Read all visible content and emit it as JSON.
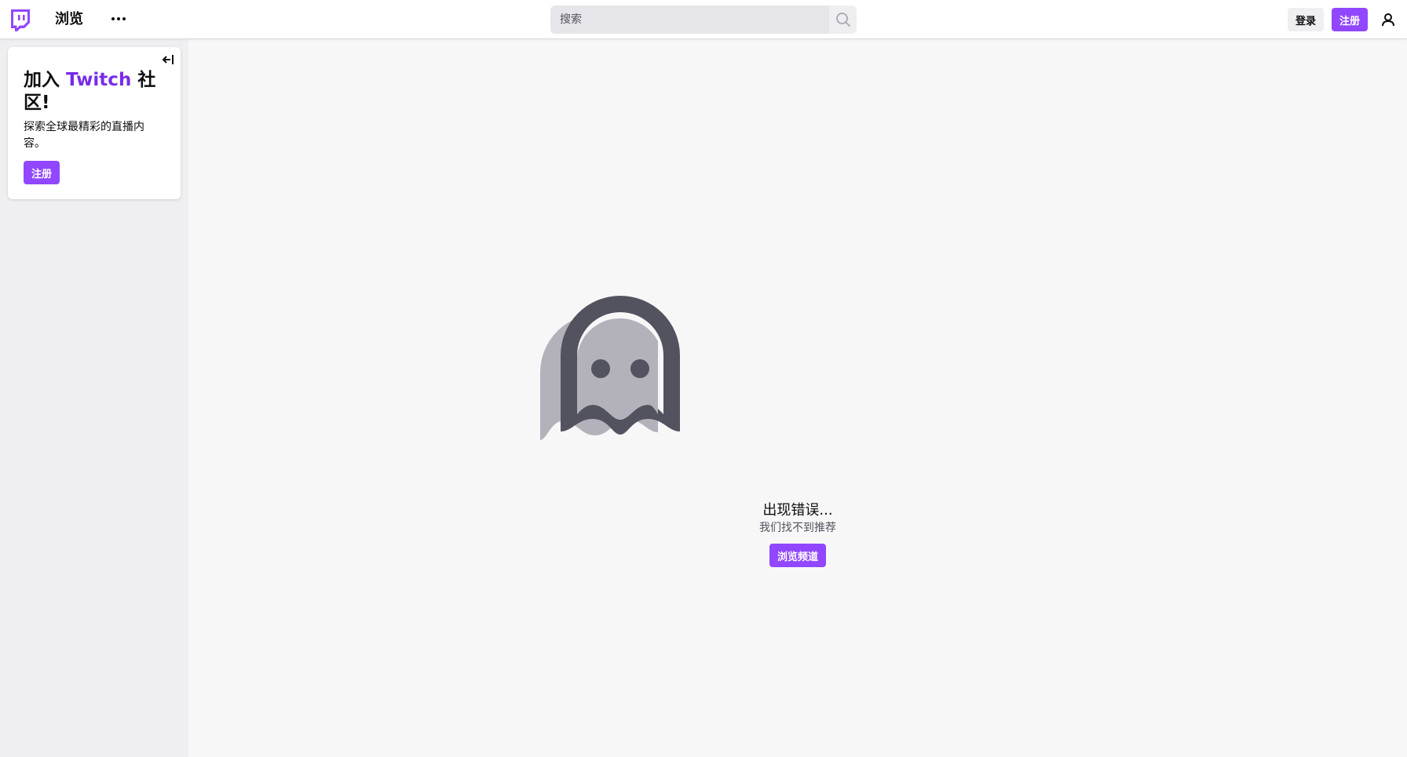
{
  "colors": {
    "brand": "#9147ff",
    "brand_text": "#772ce8",
    "ghost_dark": "#53535f",
    "ghost_light": "#b3b2bb"
  },
  "topbar": {
    "logo_icon": "twitch-glitch-icon",
    "browse_label": "浏览",
    "more_icon": "more-dots-icon",
    "search": {
      "placeholder": "搜索",
      "value": "",
      "icon": "search-icon"
    },
    "login_label": "登录",
    "signup_label": "注册",
    "user_icon": "user-icon"
  },
  "sidebar": {
    "collapse_icon": "collapse-left-icon",
    "join_card": {
      "title_prefix": "加入 ",
      "title_brand": "Twitch",
      "title_suffix": " 社区!",
      "description": "探索全球最精彩的直播内容。",
      "signup_label": "注册"
    }
  },
  "main": {
    "illustration": "ghost-icon",
    "error_title": "出现错误...",
    "error_subtitle": "我们找不到推荐",
    "browse_channels_label": "浏览频道"
  }
}
